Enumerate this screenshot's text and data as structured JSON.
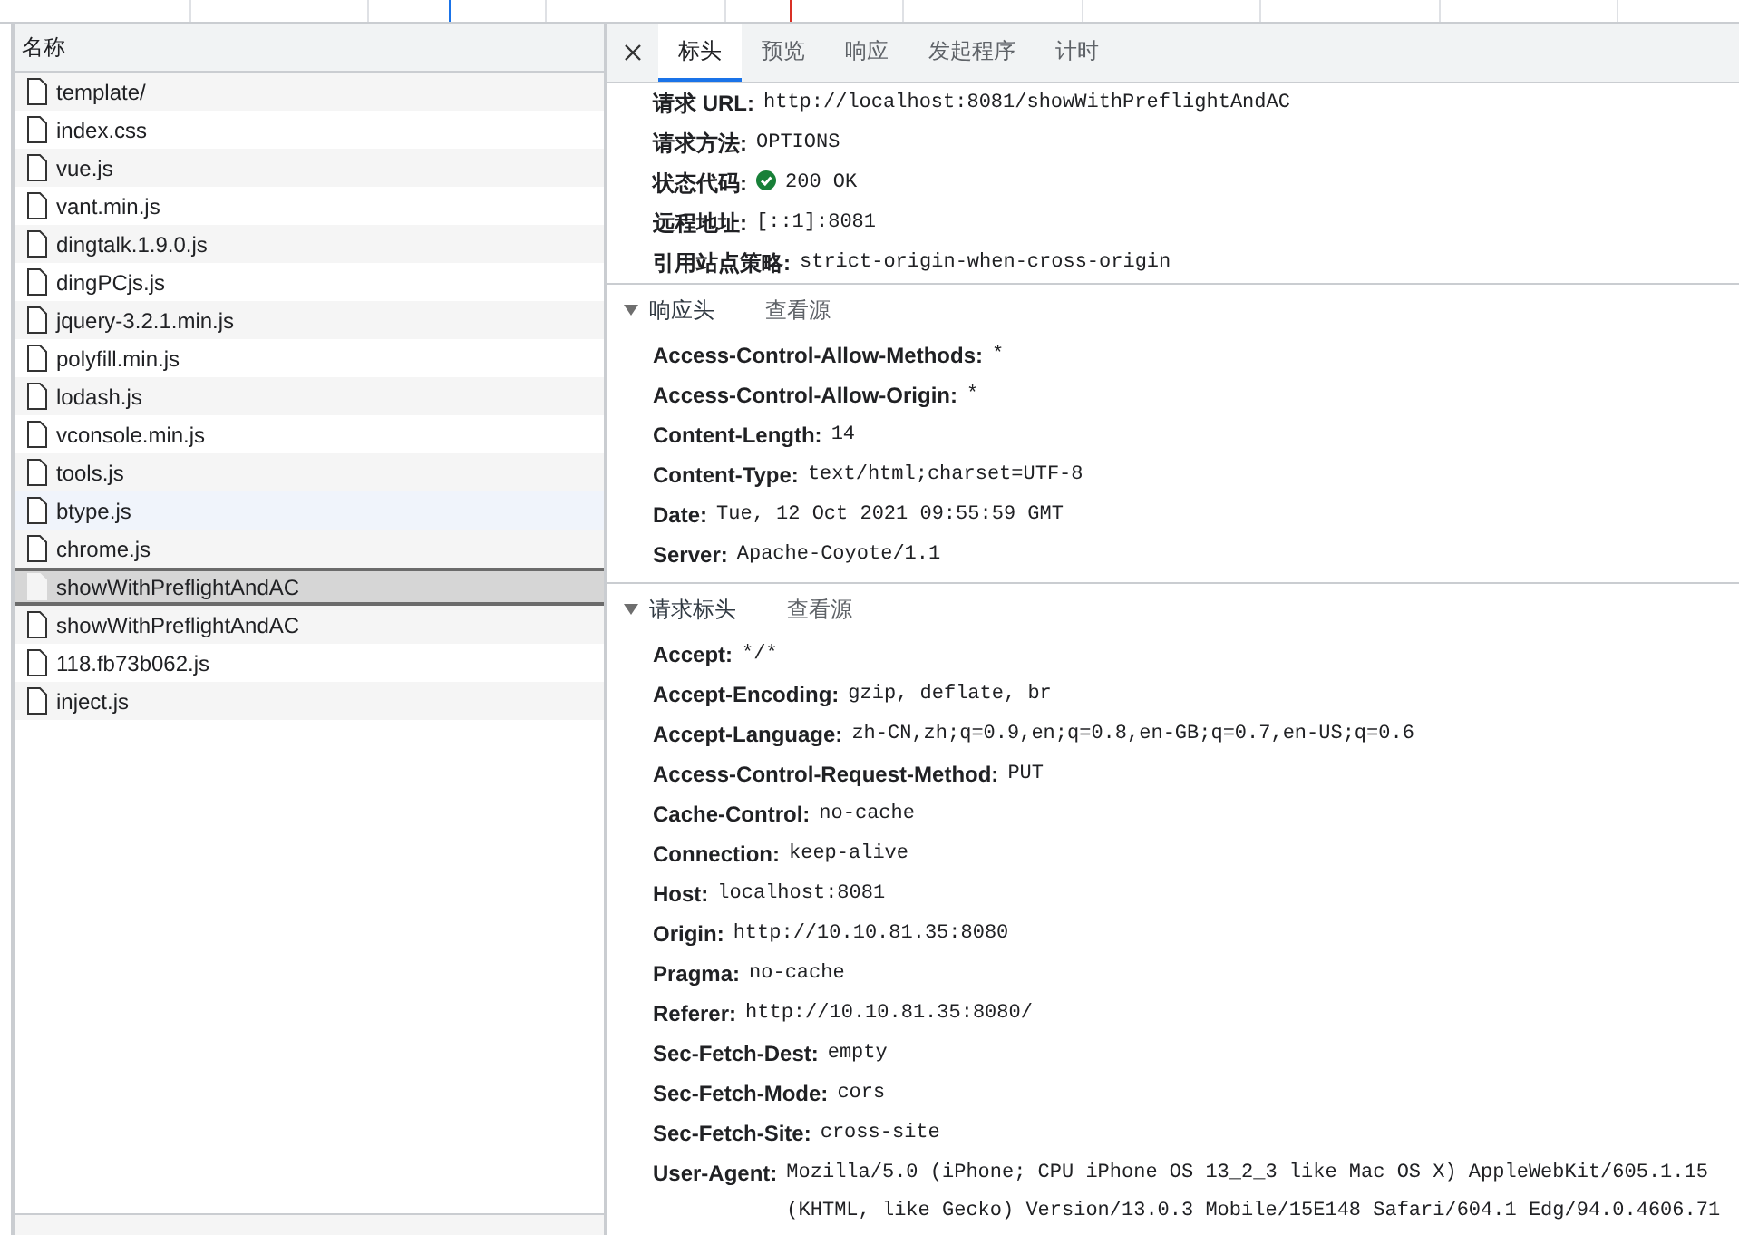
{
  "requests": {
    "header": "名称",
    "items": [
      {
        "name": "template/",
        "selected": false,
        "hovered": false
      },
      {
        "name": "index.css",
        "selected": false,
        "hovered": false
      },
      {
        "name": "vue.js",
        "selected": false,
        "hovered": false
      },
      {
        "name": "vant.min.js",
        "selected": false,
        "hovered": false
      },
      {
        "name": "dingtalk.1.9.0.js",
        "selected": false,
        "hovered": false
      },
      {
        "name": "dingPCjs.js",
        "selected": false,
        "hovered": false
      },
      {
        "name": "jquery-3.2.1.min.js",
        "selected": false,
        "hovered": false
      },
      {
        "name": "polyfill.min.js",
        "selected": false,
        "hovered": false
      },
      {
        "name": "lodash.js",
        "selected": false,
        "hovered": false
      },
      {
        "name": "vconsole.min.js",
        "selected": false,
        "hovered": false
      },
      {
        "name": "tools.js",
        "selected": false,
        "hovered": false
      },
      {
        "name": "btype.js",
        "selected": false,
        "hovered": true
      },
      {
        "name": "chrome.js",
        "selected": false,
        "hovered": false
      },
      {
        "name": "showWithPreflightAndAC",
        "selected": true,
        "hovered": false
      },
      {
        "name": "showWithPreflightAndAC",
        "selected": false,
        "hovered": false
      },
      {
        "name": "118.fb73b062.js",
        "selected": false,
        "hovered": false
      },
      {
        "name": "inject.js",
        "selected": false,
        "hovered": false
      }
    ]
  },
  "details": {
    "tabs": [
      {
        "label": "标头",
        "selected": true
      },
      {
        "label": "预览",
        "selected": false
      },
      {
        "label": "响应",
        "selected": false
      },
      {
        "label": "发起程序",
        "selected": false
      },
      {
        "label": "计时",
        "selected": false
      }
    ],
    "general": [
      {
        "kind": "text",
        "name": "请求 URL:",
        "value": "http://localhost:8081/showWithPreflightAndAC"
      },
      {
        "kind": "text",
        "name": "请求方法:",
        "value": "OPTIONS"
      },
      {
        "kind": "status",
        "name": "状态代码:",
        "value": "200 OK"
      },
      {
        "kind": "text",
        "name": "远程地址:",
        "value": "[::1]:8081"
      },
      {
        "kind": "text",
        "name": "引用站点策略:",
        "value": "strict-origin-when-cross-origin"
      }
    ],
    "sections": [
      {
        "title": "响应头",
        "source_link": "查看源",
        "expanded": true,
        "headers": [
          {
            "name": "Access-Control-Allow-Methods:",
            "value": "*"
          },
          {
            "name": "Access-Control-Allow-Origin:",
            "value": "*"
          },
          {
            "name": "Content-Length:",
            "value": "14"
          },
          {
            "name": "Content-Type:",
            "value": "text/html;charset=UTF-8"
          },
          {
            "name": "Date:",
            "value": "Tue, 12 Oct 2021 09:55:59 GMT"
          },
          {
            "name": "Server:",
            "value": "Apache-Coyote/1.1"
          }
        ]
      },
      {
        "title": "请求标头",
        "source_link": "查看源",
        "expanded": true,
        "headers": [
          {
            "name": "Accept:",
            "value": "*/*"
          },
          {
            "name": "Accept-Encoding:",
            "value": "gzip, deflate, br"
          },
          {
            "name": "Accept-Language:",
            "value": "zh-CN,zh;q=0.9,en;q=0.8,en-GB;q=0.7,en-US;q=0.6"
          },
          {
            "name": "Access-Control-Request-Method:",
            "value": "PUT"
          },
          {
            "name": "Cache-Control:",
            "value": "no-cache"
          },
          {
            "name": "Connection:",
            "value": "keep-alive"
          },
          {
            "name": "Host:",
            "value": "localhost:8081"
          },
          {
            "name": "Origin:",
            "value": "http://10.10.81.35:8080"
          },
          {
            "name": "Pragma:",
            "value": "no-cache"
          },
          {
            "name": "Referer:",
            "value": "http://10.10.81.35:8080/"
          },
          {
            "name": "Sec-Fetch-Dest:",
            "value": "empty"
          },
          {
            "name": "Sec-Fetch-Mode:",
            "value": "cors"
          },
          {
            "name": "Sec-Fetch-Site:",
            "value": "cross-site"
          },
          {
            "name": "User-Agent:",
            "value": "Mozilla/5.0 (iPhone; CPU iPhone OS 13_2_3 like Mac OS X) AppleWebKit/605.1.15 (KHTML, like Gecko) Version/13.0.3 Mobile/15E148 Safari/604.1 Edg/94.0.4606.71"
          }
        ]
      }
    ]
  }
}
